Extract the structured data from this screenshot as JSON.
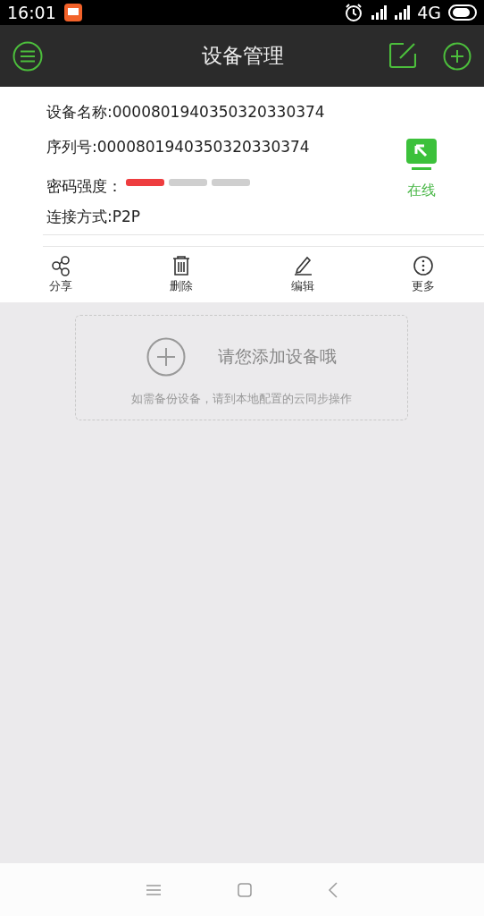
{
  "status_bar": {
    "time": "16:01",
    "network": "4G"
  },
  "header": {
    "title": "设备管理"
  },
  "device": {
    "name": "设备名称:0000801940350320330374",
    "serial": "序列号:0000801940350320330374",
    "strength_label": "密码强度：",
    "strength": {
      "level": 0.33
    },
    "connection": "连接方式:P2P",
    "status": {
      "label": "在线",
      "online": true
    }
  },
  "actions": [
    {
      "label": "分享",
      "kind": "share"
    },
    {
      "label": "删除",
      "kind": "delete"
    },
    {
      "label": "编辑",
      "kind": "edit"
    },
    {
      "label": "更多",
      "kind": "more"
    }
  ],
  "add_box": {
    "title": "请您添加设备哦",
    "hint": "如需备份设备，请到本地配置的云同步操作"
  }
}
